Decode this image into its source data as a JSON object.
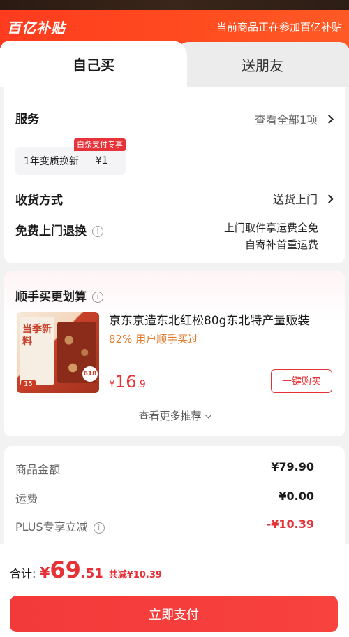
{
  "banner": {
    "logo": "百亿补贴",
    "note": "当前商品正在参加百亿补贴"
  },
  "tabs": [
    {
      "label": "自己买",
      "active": true
    },
    {
      "label": "送朋友",
      "active": false
    }
  ],
  "services": {
    "label": "服务",
    "view_all": "查看全部1项",
    "chip_tag": "白条支付专享",
    "chip_name": "1年变质换新",
    "chip_price": "¥1"
  },
  "delivery": {
    "label": "收货方式",
    "value": "送货上门"
  },
  "free_return": {
    "label": "免费上门退换",
    "note_line1": "上门取件享运费全免",
    "note_line2": "自寄补首重运费"
  },
  "bundle": {
    "title": "顺手买更划算",
    "product_title": "京东京造东北红松80g东北特产量贩装",
    "product_sub": "82% 用户顺手买过",
    "img_text": "当季新料",
    "img_badge": "618",
    "img_price": "15",
    "price_currency": "¥",
    "price_int": "16",
    "price_dec": ".9",
    "buy_label": "一键购买",
    "more_label": "查看更多推荐"
  },
  "summary": [
    {
      "label": "商品金额",
      "value": "¥79.90",
      "red": false
    },
    {
      "label": "运费",
      "value": "¥0.00",
      "red": false
    },
    {
      "label": "PLUS专享立减",
      "value": "-¥10.39",
      "red": true
    }
  ],
  "total": {
    "label": "合计:",
    "currency": "¥",
    "int": "69",
    "dec": ".51",
    "save": "共减¥10.39"
  },
  "pay_button": "立即支付",
  "colors": {
    "accent": "#e53237",
    "banner": "#ff4d1f"
  }
}
